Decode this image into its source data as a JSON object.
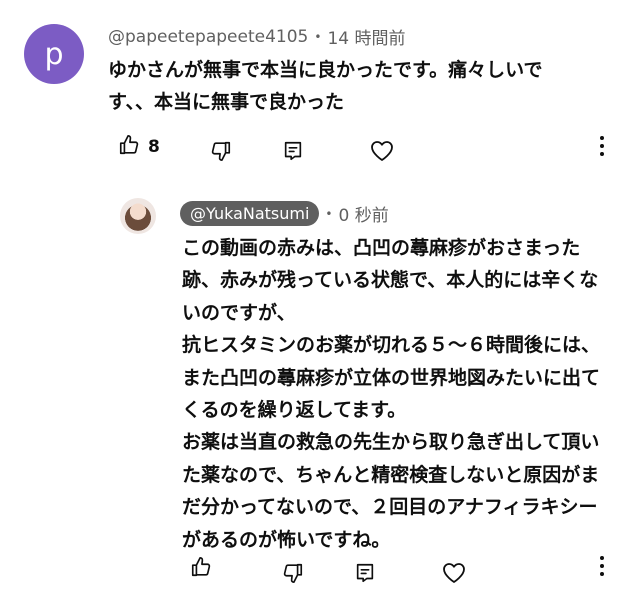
{
  "comment": {
    "avatar_letter": "p",
    "author": "@papeetepapeete4105",
    "time": "14 時間前",
    "separator": "•",
    "lines": [
      "ゆかさんが無事で本当に良かったです。痛々しいで",
      "す、、本当に無事で良かった"
    ],
    "like_count": "8"
  },
  "reply": {
    "author": "@YukaNatsumi",
    "time": "0 秒前",
    "separator": "•",
    "lines": [
      "この動画の赤みは、凸凹の蕁麻疹がおさまった",
      "跡、赤みが残っている状態で、本人的には辛くな",
      "いのですが、",
      "抗ヒスタミンのお薬が切れる５〜６時間後には、",
      "また凸凹の蕁麻疹が立体の世界地図みたいに出て",
      "くるのを繰り返してます。",
      "お薬は当直の救急の先生から取り急ぎ出して頂い",
      "た薬なので、ちゃんと精密検査しないと原因がま",
      "だ分かってないので、２回目のアナフィラキシー",
      "があるのが怖いですね。"
    ]
  },
  "colors": {
    "avatar_bg": "#7c5cc4",
    "chip_bg": "#5f5f5f",
    "meta_text": "#606060"
  },
  "icons": [
    "like-icon",
    "dislike-icon",
    "reply-icon",
    "heart-icon",
    "more-vert-icon"
  ]
}
